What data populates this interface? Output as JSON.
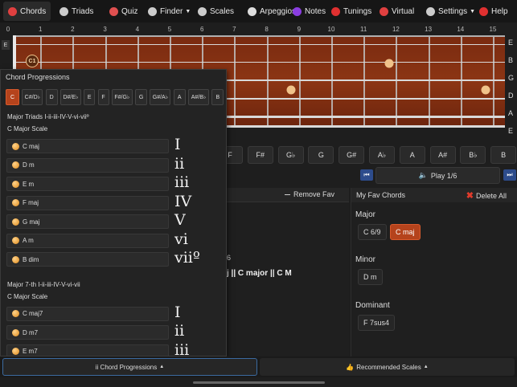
{
  "nav": [
    {
      "label": "Chords",
      "icon": "guitar-icon",
      "active": true,
      "color": "#e04040"
    },
    {
      "label": "Triads",
      "icon": "dots-icon",
      "color": "#cccccc"
    },
    {
      "label": "Quiz",
      "icon": "quiz-icon",
      "color": "#e05050"
    },
    {
      "label": "Finder",
      "icon": "magnifier-icon",
      "dropdown": true,
      "color": "#cccccc"
    },
    {
      "label": "Scales",
      "icon": "scales-icon",
      "color": "#cccccc"
    },
    {
      "label": "Arpeggios",
      "icon": "arpeggio-icon",
      "color": "#dddddd"
    },
    {
      "label": "Notes",
      "icon": "notes-icon",
      "color": "#8a3de0"
    },
    {
      "label": "Tunings",
      "icon": "tuning-icon",
      "color": "#e03030"
    },
    {
      "label": "Virtual",
      "icon": "guitar-icon",
      "color": "#e04040"
    },
    {
      "label": "Settings",
      "icon": "gear-icon",
      "dropdown": true,
      "color": "#cccccc"
    },
    {
      "label": "Help",
      "icon": "question-icon",
      "color": "#e03030"
    }
  ],
  "frets": [
    "0",
    "1",
    "2",
    "3",
    "4",
    "5",
    "6",
    "7",
    "8",
    "9",
    "10",
    "11",
    "12",
    "13",
    "14",
    "15"
  ],
  "strings": [
    "E",
    "B",
    "G",
    "D",
    "A",
    "E"
  ],
  "fretboard": {
    "left_tag": "E",
    "marker": "C1"
  },
  "keys": [
    "F",
    "F#",
    "G♭",
    "G",
    "G#",
    "A♭",
    "A",
    "A#",
    "B♭",
    "B"
  ],
  "play": {
    "label": "Play 1/6"
  },
  "middle": {
    "remove_fav": "Remove Fav",
    "text1": "6",
    "text2": "j || C major || C M"
  },
  "favorites": {
    "title": "My Fav Chords",
    "delete_all": "Delete All",
    "sections": [
      {
        "label": "Major",
        "chords": [
          {
            "name": "C 6/9",
            "selected": false
          },
          {
            "name": "C maj",
            "selected": true
          }
        ]
      },
      {
        "label": "Minor",
        "chords": [
          {
            "name": "D m",
            "selected": false
          }
        ]
      },
      {
        "label": "Dominant",
        "chords": [
          {
            "name": "F 7sus4",
            "selected": false
          }
        ]
      }
    ]
  },
  "popup": {
    "title": "Chord Progressions",
    "key_tabs": [
      "C",
      "C#/D♭",
      "D",
      "D#/E♭",
      "E",
      "F",
      "F#/G♭",
      "G",
      "G#/A♭",
      "A",
      "A#/B♭",
      "B"
    ],
    "selected_key": "C",
    "sections": [
      {
        "label": "Major Triads I-ii-iii-IV-V-vi-viiº",
        "scale": "C Major Scale",
        "chords": [
          {
            "name": "C maj",
            "roman": "I"
          },
          {
            "name": "D m",
            "roman": "ii"
          },
          {
            "name": "E m",
            "roman": "iii"
          },
          {
            "name": "F maj",
            "roman": "IV"
          },
          {
            "name": "G maj",
            "roman": "V"
          },
          {
            "name": "A m",
            "roman": "vi"
          },
          {
            "name": "B dim",
            "roman": "viiº"
          }
        ]
      },
      {
        "label": "Major 7-th I-ii-iii-IV-V-vi-vii",
        "scale": "C Major Scale",
        "chords": [
          {
            "name": "C maj7",
            "roman": "I"
          },
          {
            "name": "D m7",
            "roman": "ii"
          },
          {
            "name": "E m7",
            "roman": "iii"
          }
        ]
      }
    ]
  },
  "bottom": {
    "progressions": "ii Chord Progressions",
    "scales": "Recommended Scales"
  }
}
